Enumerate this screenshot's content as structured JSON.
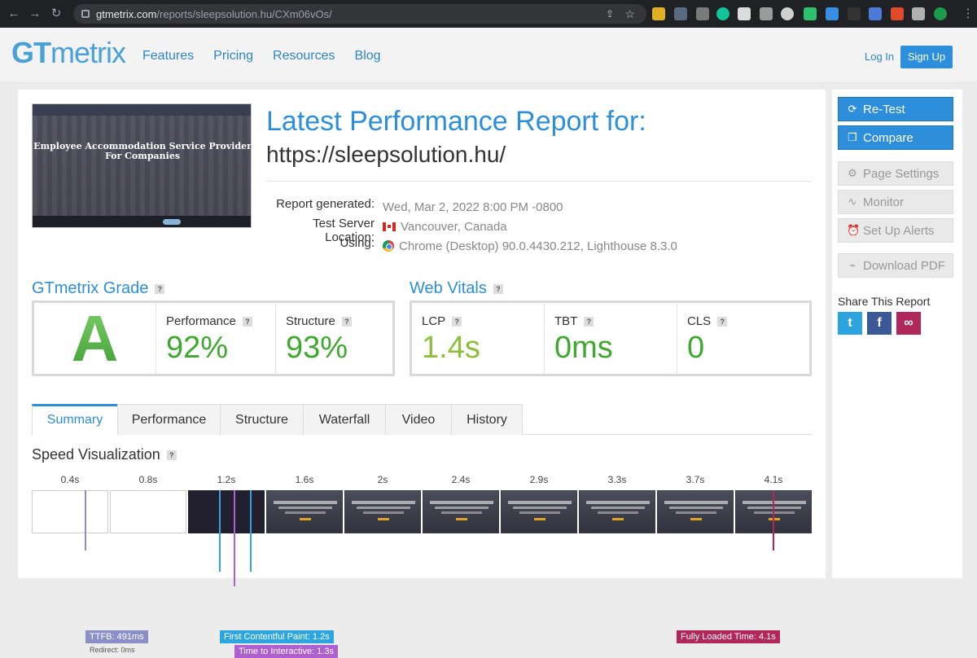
{
  "browser": {
    "url_host": "gtmetrix.com",
    "url_path": "/reports/sleepsolution.hu/CXm06vOs/"
  },
  "header": {
    "logo_gt": "GT",
    "logo_metrix": "metrix",
    "nav": [
      "Features",
      "Pricing",
      "Resources",
      "Blog"
    ],
    "login": "Log In",
    "signup": "Sign Up"
  },
  "report": {
    "thumb_title": "Employee Accommodation Service Provider For Companies",
    "title": "Latest Performance Report for:",
    "url": "https://sleepsolution.hu/",
    "meta": [
      {
        "label": "Report generated:",
        "value": "Wed, Mar 2, 2022 8:00 PM -0800"
      },
      {
        "label": "Test Server Location:",
        "value": "Vancouver, Canada"
      },
      {
        "label": "Using:",
        "value": "Chrome (Desktop) 90.0.4430.212, Lighthouse 8.3.0"
      }
    ]
  },
  "grade": {
    "title": "GTmetrix Grade",
    "letter": "A",
    "performance_label": "Performance",
    "performance_value": "92%",
    "structure_label": "Structure",
    "structure_value": "93%"
  },
  "vitals": {
    "title": "Web Vitals",
    "lcp_label": "LCP",
    "lcp_value": "1.4s",
    "tbt_label": "TBT",
    "tbt_value": "0ms",
    "cls_label": "CLS",
    "cls_value": "0"
  },
  "tabs": [
    "Summary",
    "Performance",
    "Structure",
    "Waterfall",
    "Video",
    "History"
  ],
  "speed": {
    "title": "Speed Visualization",
    "ticks": [
      "0.4s",
      "0.8s",
      "1.2s",
      "1.6s",
      "2s",
      "2.4s",
      "2.9s",
      "3.3s",
      "3.7s",
      "4.1s"
    ],
    "markers": {
      "ttfb": "TTFB: 491ms",
      "redirect": "Redirect: 0ms",
      "fcp": "First Contentful Paint: 1.2s",
      "tti": "Time to Interactive: 1.3s",
      "fully": "Fully Loaded Time: 4.1s"
    }
  },
  "sidebar": {
    "retest": "Re-Test",
    "compare": "Compare",
    "page_settings": "Page Settings",
    "monitor": "Monitor",
    "alerts": "Set Up Alerts",
    "pdf": "Download PDF",
    "share": "Share This Report"
  },
  "colors": {
    "brand_blue": "#2d8fdb",
    "grade_green": "#59b14a",
    "lcp_green": "#8fbf3a",
    "ttfb": "#8b8fc7",
    "fcp": "#2da6e0",
    "tti": "#b05fd0",
    "fully": "#b3265a"
  }
}
